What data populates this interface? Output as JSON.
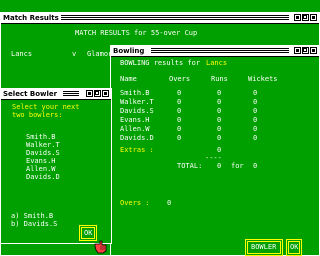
{
  "match_window": {
    "title": "Match Results",
    "heading": "MATCH RESULTS for 55-over Cup",
    "team1": "Lancs",
    "vs": "v",
    "team2": "Glamorgan"
  },
  "bowling_window": {
    "title": "Bowling",
    "results_label": "BOWLING results for",
    "team": "Lancs",
    "headers": {
      "name": "Name",
      "overs": "Overs",
      "runs": "Runs",
      "wickets": "Wickets"
    },
    "rows": [
      {
        "name": "Smith.B",
        "overs": "0",
        "runs": "0",
        "wickets": "0"
      },
      {
        "name": "Walker.T",
        "overs": "0",
        "runs": "0",
        "wickets": "0"
      },
      {
        "name": "Davids.S",
        "overs": "0",
        "runs": "0",
        "wickets": "0"
      },
      {
        "name": "Evans.H",
        "overs": "0",
        "runs": "0",
        "wickets": "0"
      },
      {
        "name": "Allen.W",
        "overs": "0",
        "runs": "0",
        "wickets": "0"
      },
      {
        "name": "Davids.D",
        "overs": "0",
        "runs": "0",
        "wickets": "0"
      }
    ],
    "extras_label": "Extras :",
    "extras_value": "0",
    "divider": "----",
    "total_label": "TOTAL:",
    "total_runs": "0",
    "for_label": "for",
    "total_wickets": "0",
    "overs_label": "Overs :",
    "overs_value": "0",
    "bowler_button": "BOWLER",
    "ok_button": "OK"
  },
  "select_window": {
    "title": "Select Bowler",
    "prompt_line1": "Select your next",
    "prompt_line2": "two bowlers:",
    "bowlers": [
      "Smith.B",
      "Walker.T",
      "Davids.S",
      "Evans.H",
      "Allen.W",
      "Davids.D"
    ],
    "choice_a": "a) Smith.B",
    "choice_b": "b) Davids.S",
    "ok_button": "OK"
  },
  "colors": {
    "background": "#00a000",
    "text": "#ffffff",
    "highlight": "#ffff00",
    "titlebar": "#ffffff"
  },
  "icons": {
    "cursor": "pointing-hand-icon"
  }
}
